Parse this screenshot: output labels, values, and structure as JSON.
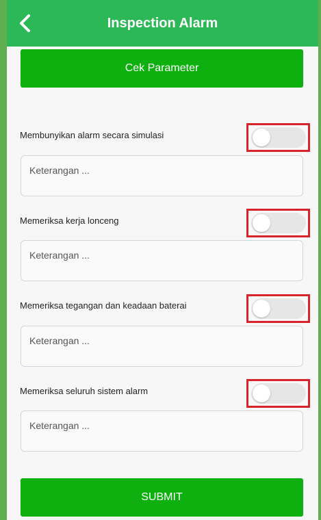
{
  "header": {
    "title": "Inspection Alarm",
    "back_icon": "chevron-left-icon"
  },
  "cek_parameter_label": "Cek Parameter",
  "items": [
    {
      "label": "Membunyikan alarm secara simulasi",
      "toggle_on": false,
      "placeholder": "Keterangan ..."
    },
    {
      "label": "Memeriksa kerja lonceng",
      "toggle_on": false,
      "placeholder": "Keterangan ..."
    },
    {
      "label": "Memeriksa tegangan dan keadaan baterai",
      "toggle_on": false,
      "placeholder": "Keterangan ..."
    },
    {
      "label": "Memeriksa seluruh sistem alarm",
      "toggle_on": false,
      "placeholder": "Keterangan ..."
    }
  ],
  "submit_label": "SUBMIT",
  "colors": {
    "header": "#2db857",
    "button": "#0db00f",
    "highlight": "#d9232b"
  }
}
